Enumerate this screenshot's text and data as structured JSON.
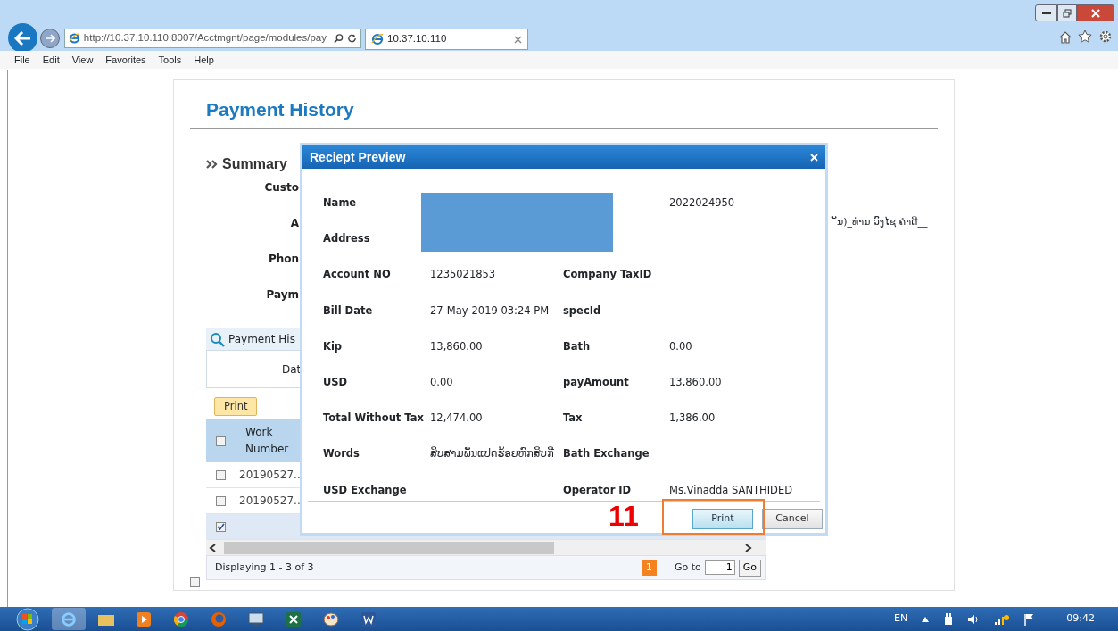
{
  "browser": {
    "address": "http://10.37.10.110:8007/Acctmgnt/page/modules/pay",
    "tab_title": "10.37.10.110",
    "menu": [
      "File",
      "Edit",
      "View",
      "Favorites",
      "Tools",
      "Help"
    ]
  },
  "page": {
    "title": "Payment History",
    "section": "Summary",
    "summary_labels": [
      "Custo",
      "A",
      "Phon",
      "Paym"
    ],
    "summary_value": "ັນ)_ທ່ານ ວົງໄຊ ຄຳດີ__",
    "grid": {
      "title": "Payment His",
      "filter_label": "Dat",
      "print_button": "Print",
      "header_checked": false,
      "column": "Work Number",
      "rows": [
        {
          "work_number": "20190527..",
          "selected": false
        },
        {
          "work_number": "20190527..",
          "selected": false
        },
        {
          "selected": true
        }
      ],
      "pager_text": "Displaying 1 - 3 of 3",
      "pages": [
        {
          "label": "1",
          "selected": true
        }
      ],
      "goto_label": "Go to",
      "goto_value": "1",
      "go_button": "Go"
    },
    "footer_checked": false
  },
  "dialog": {
    "title": "Reciept Preview",
    "redacted": true,
    "rows": [
      {
        "label": "Name",
        "value_2": "2022024950"
      },
      {
        "label": "Address"
      },
      {
        "label": "Account NO",
        "value": "1235021853",
        "label_2": "Company TaxID"
      },
      {
        "label": "Bill Date",
        "value": "27-May-2019 03:24 PM",
        "label_2": "specId"
      },
      {
        "label": "Kip",
        "value": "13,860.00",
        "label_2": "Bath",
        "value_2": "0.00"
      },
      {
        "label": "USD",
        "value": "0.00",
        "label_2": "payAmount",
        "value_2": "13,860.00"
      },
      {
        "label": "Total Without Tax",
        "value": "12,474.00",
        "label_2": "Tax",
        "value_2": "1,386.00"
      },
      {
        "label": "Words",
        "value": "ສິບສາມພັນແປດຮ້ອຍຫົກສິບກີ",
        "label_2": "Bath Exchange"
      },
      {
        "label": "USD Exchange",
        "label_2": "Operator ID",
        "value_2": "Ms.Vinadda SANTHIDED"
      }
    ],
    "buttons": [
      {
        "label": "Print",
        "kind": "primary"
      },
      {
        "label": "Cancel",
        "kind": "default"
      }
    ]
  },
  "annotation": {
    "step": "11"
  },
  "taskbar": {
    "language": "EN",
    "clock": "09:42"
  }
}
